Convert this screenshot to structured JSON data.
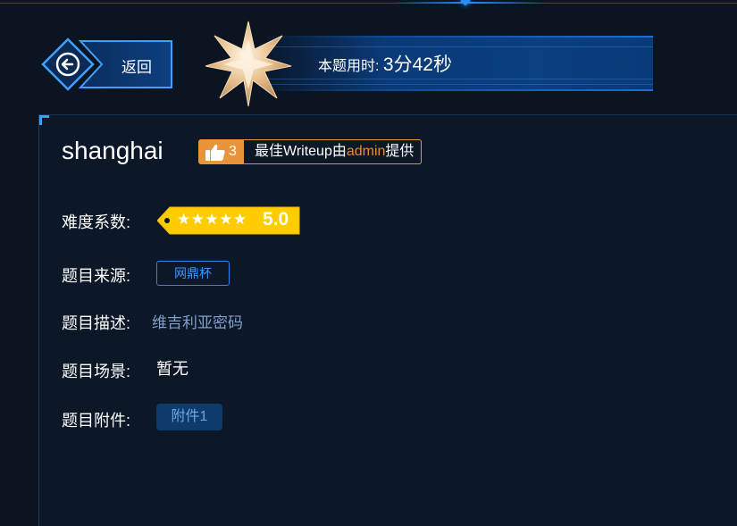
{
  "header": {
    "back_label": "返回",
    "timer_label": "本题用时:",
    "timer_value": "3分42秒"
  },
  "challenge": {
    "title": "shanghai",
    "likes": "3",
    "writeup_prefix": "最佳Writeup由",
    "writeup_author": "admin",
    "writeup_suffix": "提供"
  },
  "fields": {
    "difficulty_label": "难度系数:",
    "difficulty_stars": "★★★★★",
    "difficulty_value": "5.0",
    "source_label": "题目来源:",
    "source_value": "网鼎杯",
    "description_label": "题目描述:",
    "description_value": "维吉利亚密码",
    "scene_label": "题目场景:",
    "scene_value": "暂无",
    "attachment_label": "题目附件:",
    "attachment_value": "附件1"
  },
  "colors": {
    "accent_orange": "#e9943b",
    "accent_blue": "#2f84f0",
    "rating_yellow": "#ffcc00",
    "background": "#0b1522"
  },
  "icons": {
    "back": "arrow-left-icon",
    "badge": "star-badge-icon",
    "like": "thumbs-up-icon"
  }
}
